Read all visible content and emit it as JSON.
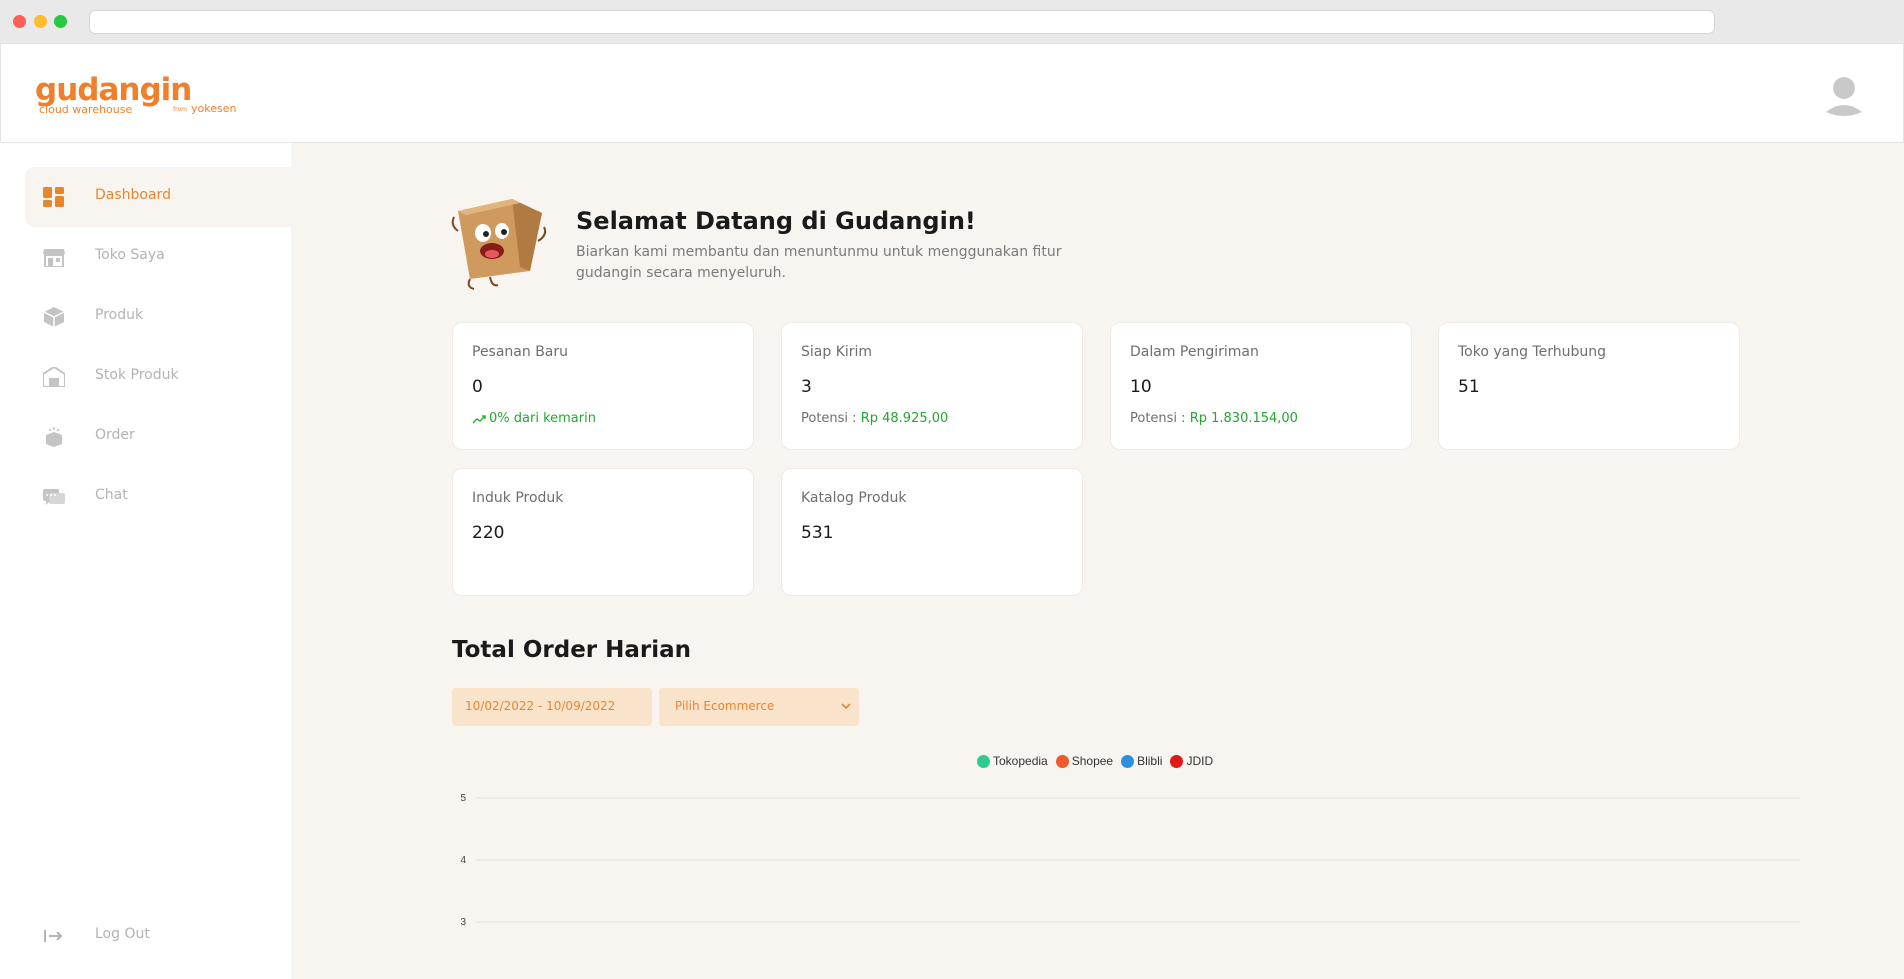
{
  "header": {
    "logo_main": "gudangin",
    "logo_sub": "cloud warehouse",
    "logo_from": "from",
    "logo_brand": "yokesen"
  },
  "sidebar": {
    "items": [
      {
        "label": "Dashboard",
        "icon": "dashboard-icon",
        "active": true
      },
      {
        "label": "Toko Saya",
        "icon": "store-icon",
        "active": false
      },
      {
        "label": "Produk",
        "icon": "box-icon",
        "active": false
      },
      {
        "label": "Stok Produk",
        "icon": "warehouse-icon",
        "active": false
      },
      {
        "label": "Order",
        "icon": "order-box-icon",
        "active": false
      },
      {
        "label": "Chat",
        "icon": "chat-icon",
        "active": false
      }
    ],
    "logout_label": "Log Out"
  },
  "welcome": {
    "title": "Selamat Datang di Gudangin!",
    "description": "Biarkan kami membantu dan menuntunmu untuk menggunakan fitur gudangin secara menyeluruh."
  },
  "cards": [
    {
      "title": "Pesanan Baru",
      "value": "0",
      "foot_text": "0% dari kemarin"
    },
    {
      "title": "Siap Kirim",
      "value": "3",
      "foot_label": "Potensi : ",
      "foot_value": "Rp 48.925,00"
    },
    {
      "title": "Dalam Pengiriman",
      "value": "10",
      "foot_label": "Potensi : ",
      "foot_value": "Rp 1.830.154,00"
    },
    {
      "title": "Toko yang Terhubung",
      "value": "51"
    },
    {
      "title": "Induk Produk",
      "value": "220"
    },
    {
      "title": "Katalog Produk",
      "value": "531"
    }
  ],
  "order_section": {
    "title": "Total Order Harian",
    "date_range": "10/02/2022 - 10/09/2022",
    "ecommerce_select": "Pilih Ecommerce"
  },
  "colors": {
    "accent": "#e8862f",
    "green": "#22a82f"
  },
  "chart_data": {
    "type": "line",
    "series": [
      {
        "name": "Tokopedia",
        "color": "#2ecc8f",
        "values": []
      },
      {
        "name": "Shopee",
        "color": "#ee5a2f",
        "values": []
      },
      {
        "name": "Blibli",
        "color": "#2d8fe0",
        "values": []
      },
      {
        "name": "JDID",
        "color": "#e01818",
        "values": []
      }
    ],
    "y_ticks": [
      "5",
      "4",
      "3"
    ],
    "grid": true,
    "legend_position": "top-center"
  }
}
